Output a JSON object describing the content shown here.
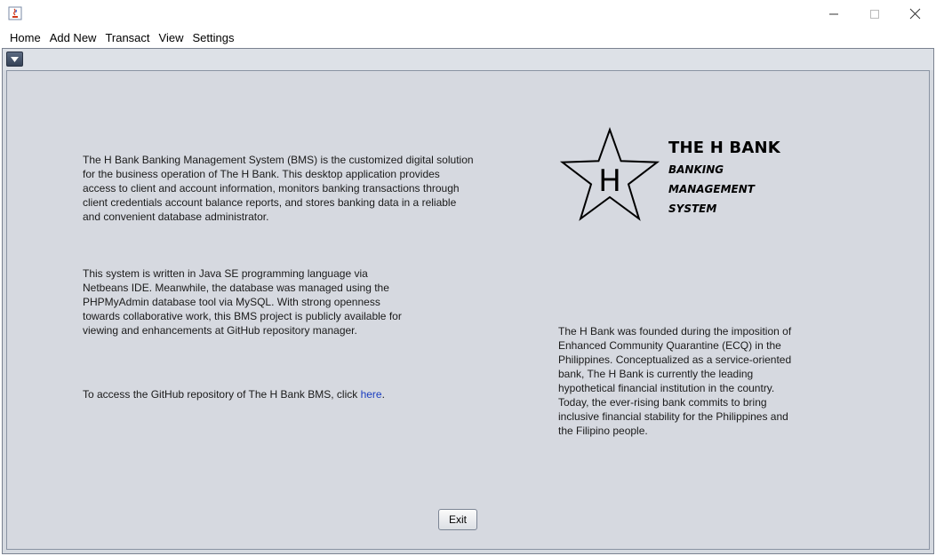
{
  "window": {
    "minimize_icon": "minimize-icon",
    "maximize_icon": "maximize-icon",
    "close_icon": "close-icon"
  },
  "menu": {
    "items": [
      "Home",
      "Add New",
      "Transact",
      "View",
      "Settings"
    ]
  },
  "content": {
    "paragraph1": [
      "The H Bank Banking Management System (BMS) is the customized digital solution",
      "for the business operation of The H Bank. This desktop application provides",
      "access to client and account information, monitors banking transactions through",
      "client credentials account balance reports, and stores banking data in a reliable",
      "and convenient database administrator."
    ],
    "paragraph2": [
      "This system is written in Java SE programming language via",
      "Netbeans IDE. Meanwhile, the database was managed using the",
      "PHPMyAdmin database tool via MySQL. With strong openness",
      "towards collaborative work, this BMS project is publicly available for",
      "viewing and enhancements at GitHub repository manager."
    ],
    "github_prefix": "To access the GitHub repository of The H Bank BMS, click ",
    "github_link": "here",
    "github_suffix": ".",
    "about": [
      "The H Bank was founded during the imposition of",
      "Enhanced Community Quarantine (ECQ) in the",
      "Philippines. Conceptualized as a service-oriented",
      "bank, The H Bank is currently the leading",
      "hypothetical financial institution in the country.",
      "Today, the ever-rising bank commits to bring",
      "inclusive financial stability for the Philippines and",
      "the Filipino people."
    ]
  },
  "logo": {
    "letter": "H",
    "title": "THE H BANK",
    "line1": "BANKING",
    "line2": "MANAGEMENT",
    "line3": "SYSTEM"
  },
  "exit_label": "Exit",
  "colors": {
    "panel_bg": "#d6d9e0",
    "link": "#1a3dbf"
  }
}
